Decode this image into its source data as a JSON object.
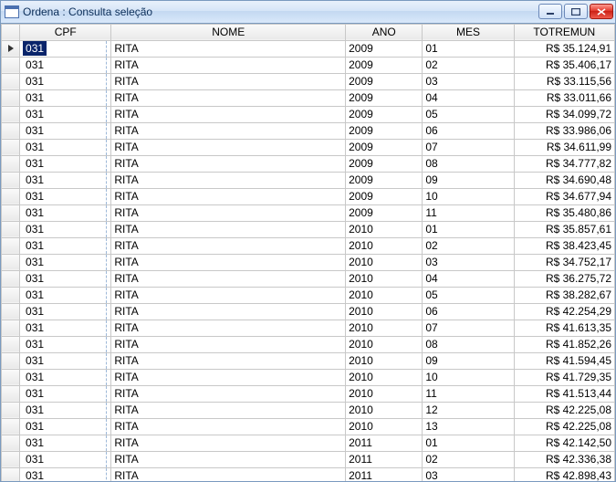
{
  "window": {
    "title": "Ordena : Consulta seleção"
  },
  "grid": {
    "columns": {
      "cpf": "CPF",
      "nome": "NOME",
      "ano": "ANO",
      "mes": "MES",
      "totremun": "TOTREMUN"
    },
    "rows": [
      {
        "cpf": "031",
        "nome": "RITA",
        "ano": "2009",
        "mes": "01",
        "totremun": "R$ 35.124,91",
        "selected": true
      },
      {
        "cpf": "031",
        "nome": "RITA",
        "ano": "2009",
        "mes": "02",
        "totremun": "R$ 35.406,17"
      },
      {
        "cpf": "031",
        "nome": "RITA",
        "ano": "2009",
        "mes": "03",
        "totremun": "R$ 33.115,56"
      },
      {
        "cpf": "031",
        "nome": "RITA",
        "ano": "2009",
        "mes": "04",
        "totremun": "R$ 33.011,66"
      },
      {
        "cpf": "031",
        "nome": "RITA",
        "ano": "2009",
        "mes": "05",
        "totremun": "R$ 34.099,72"
      },
      {
        "cpf": "031",
        "nome": "RITA",
        "ano": "2009",
        "mes": "06",
        "totremun": "R$ 33.986,06"
      },
      {
        "cpf": "031",
        "nome": "RITA",
        "ano": "2009",
        "mes": "07",
        "totremun": "R$ 34.611,99"
      },
      {
        "cpf": "031",
        "nome": "RITA",
        "ano": "2009",
        "mes": "08",
        "totremun": "R$ 34.777,82"
      },
      {
        "cpf": "031",
        "nome": "RITA",
        "ano": "2009",
        "mes": "09",
        "totremun": "R$ 34.690,48"
      },
      {
        "cpf": "031",
        "nome": "RITA",
        "ano": "2009",
        "mes": "10",
        "totremun": "R$ 34.677,94"
      },
      {
        "cpf": "031",
        "nome": "RITA",
        "ano": "2009",
        "mes": "11",
        "totremun": "R$ 35.480,86"
      },
      {
        "cpf": "031",
        "nome": "RITA",
        "ano": "2010",
        "mes": "01",
        "totremun": "R$ 35.857,61"
      },
      {
        "cpf": "031",
        "nome": "RITA",
        "ano": "2010",
        "mes": "02",
        "totremun": "R$ 38.423,45"
      },
      {
        "cpf": "031",
        "nome": "RITA",
        "ano": "2010",
        "mes": "03",
        "totremun": "R$ 34.752,17"
      },
      {
        "cpf": "031",
        "nome": "RITA",
        "ano": "2010",
        "mes": "04",
        "totremun": "R$ 36.275,72"
      },
      {
        "cpf": "031",
        "nome": "RITA",
        "ano": "2010",
        "mes": "05",
        "totremun": "R$ 38.282,67"
      },
      {
        "cpf": "031",
        "nome": "RITA",
        "ano": "2010",
        "mes": "06",
        "totremun": "R$ 42.254,29"
      },
      {
        "cpf": "031",
        "nome": "RITA",
        "ano": "2010",
        "mes": "07",
        "totremun": "R$ 41.613,35"
      },
      {
        "cpf": "031",
        "nome": "RITA",
        "ano": "2010",
        "mes": "08",
        "totremun": "R$ 41.852,26"
      },
      {
        "cpf": "031",
        "nome": "RITA",
        "ano": "2010",
        "mes": "09",
        "totremun": "R$ 41.594,45"
      },
      {
        "cpf": "031",
        "nome": "RITA",
        "ano": "2010",
        "mes": "10",
        "totremun": "R$ 41.729,35"
      },
      {
        "cpf": "031",
        "nome": "RITA",
        "ano": "2010",
        "mes": "11",
        "totremun": "R$ 41.513,44"
      },
      {
        "cpf": "031",
        "nome": "RITA",
        "ano": "2010",
        "mes": "12",
        "totremun": "R$ 42.225,08"
      },
      {
        "cpf": "031",
        "nome": "RITA",
        "ano": "2010",
        "mes": "13",
        "totremun": "R$ 42.225,08"
      },
      {
        "cpf": "031",
        "nome": "RITA",
        "ano": "2011",
        "mes": "01",
        "totremun": "R$ 42.142,50"
      },
      {
        "cpf": "031",
        "nome": "RITA",
        "ano": "2011",
        "mes": "02",
        "totremun": "R$ 42.336,38"
      },
      {
        "cpf": "031",
        "nome": "RITA",
        "ano": "2011",
        "mes": "03",
        "totremun": "R$ 42.898,43"
      }
    ]
  }
}
